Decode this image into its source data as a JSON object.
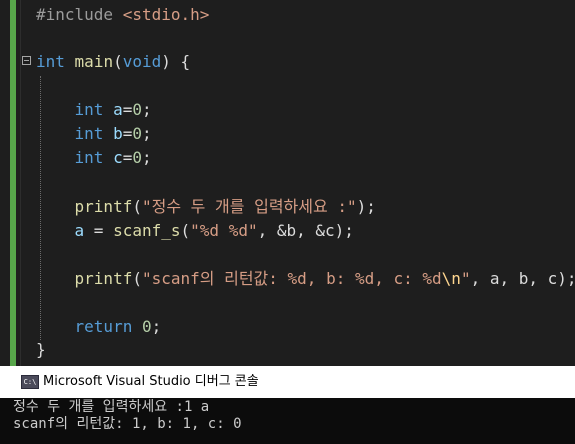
{
  "editor": {
    "lines": {
      "include": {
        "directive": "#include",
        "header": "<stdio.h>"
      },
      "main_sig": {
        "type": "int",
        "name": "main",
        "params": "(void)",
        "brace": "{"
      },
      "decl_a": {
        "type": "int",
        "var": "a",
        "value": "0"
      },
      "decl_b": {
        "type": "int",
        "var": "b",
        "value": "0"
      },
      "decl_c": {
        "type": "int",
        "var": "c",
        "value": "0"
      },
      "printf1": {
        "fn": "printf",
        "str": "\"정수 두 개를 입력하세요 :\""
      },
      "scanf": {
        "var": "a",
        "fn": "scanf_s",
        "str": "\"%d %d\"",
        "args": ", &b, &c);"
      },
      "printf2": {
        "fn": "printf",
        "str_a": "\"scanf의 리턴값: %d, b: %d, c: %d",
        "esc": "\\n",
        "str_b": "\"",
        "args": ", a, b, c);"
      },
      "ret": {
        "kw": "return",
        "value": "0"
      },
      "close": "}"
    }
  },
  "console": {
    "icon_label": "C:\\",
    "title": "Microsoft Visual Studio 디버그 콘솔",
    "output": [
      "정수 두 개를 입력하세요 :1 a",
      "scanf의 리턴값: 1, b: 1, c: 0"
    ]
  }
}
